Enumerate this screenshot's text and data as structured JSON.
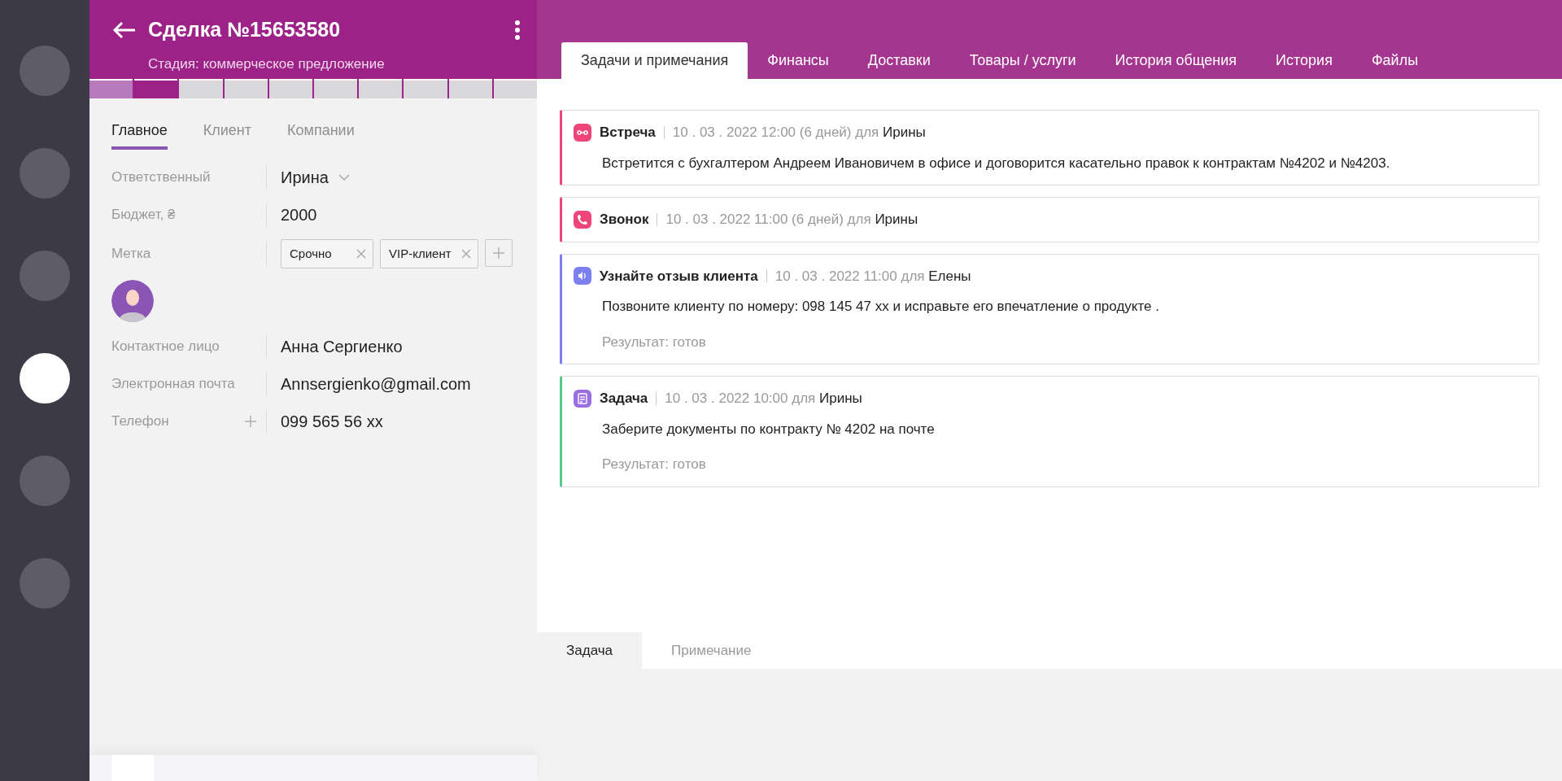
{
  "rail": [
    {
      "selected": false
    },
    {
      "selected": false
    },
    {
      "selected": false
    },
    {
      "selected": true
    },
    {
      "selected": false
    },
    {
      "selected": false
    }
  ],
  "header": {
    "title": "Сделка №15653580",
    "subtitle": "Стадия: коммерческое предложение"
  },
  "stages": [
    {
      "kind": "done"
    },
    {
      "kind": "current"
    },
    {
      "kind": "pending"
    },
    {
      "kind": "pending"
    },
    {
      "kind": "pending"
    },
    {
      "kind": "pending"
    },
    {
      "kind": "pending"
    },
    {
      "kind": "pending"
    },
    {
      "kind": "pending"
    },
    {
      "kind": "pending"
    }
  ],
  "left_tabs": [
    {
      "label": "Главное",
      "selected": true
    },
    {
      "label": "Клиент",
      "selected": false
    },
    {
      "label": "Компании",
      "selected": false
    }
  ],
  "fields": [
    {
      "kind": "dropdown",
      "label": "Ответственный",
      "value": "Ирина"
    },
    {
      "kind": "text",
      "label": "Бюджет, ₴",
      "value": "2000"
    },
    {
      "kind": "tags",
      "label": "Метка",
      "tags": [
        "Срочно",
        "VIP-клиент"
      ]
    },
    {
      "kind": "avatar"
    },
    {
      "kind": "text",
      "label": "Контактное лицо",
      "value": "Анна Сергиенко"
    },
    {
      "kind": "text",
      "label": "Электронная почта",
      "value": "Annsergienko@gmail.com"
    },
    {
      "kind": "addable",
      "label": "Телефон",
      "value": "099 565 56 xx"
    }
  ],
  "tabs": [
    {
      "label": "Задачи и примечания",
      "selected": true
    },
    {
      "label": "Финансы",
      "selected": false
    },
    {
      "label": "Доставки",
      "selected": false
    },
    {
      "label": "Товары / услуги",
      "selected": false
    },
    {
      "label": "История общения",
      "selected": false
    },
    {
      "label": "История",
      "selected": false
    },
    {
      "label": "Файлы",
      "selected": false
    }
  ],
  "tasks": [
    {
      "kind": "meeting",
      "color": "#f0457b",
      "title": "Встреча",
      "date": "10 . 03 . 2022 12:00 (6 дней) для",
      "person": "Ирины",
      "text": "Встретится с бухгалтером Андреем Ивановичем в офисе и договорится касательно правок к контрактам №4202 и №4203."
    },
    {
      "kind": "call",
      "color": "#f0457b",
      "title": "Звонок",
      "date": "10 . 03 . 2022 11:00 (6 дней) для",
      "person": "Ирины"
    },
    {
      "kind": "feedback",
      "color": "#7b80ee",
      "title": "Узнайте отзыв клиента",
      "date": "10 . 03 . 2022 11:00 для",
      "person": "Елены",
      "text": "Позвоните клиенту по номеру: 098 145 47 xx и исправьте его впечатление о продукте .",
      "result": "Результат: готов"
    },
    {
      "kind": "task",
      "color": "#5cc98b",
      "title": "Задача",
      "date": "10 . 03 . 2022 10:00 для",
      "person": "Ирины",
      "text": "Заберите документы по контракту № 4202 на почте",
      "result": "Результат: готов"
    }
  ],
  "bottom_tabs": [
    {
      "label": "Задача",
      "selected": true
    },
    {
      "label": "Примечание",
      "selected": false
    }
  ]
}
